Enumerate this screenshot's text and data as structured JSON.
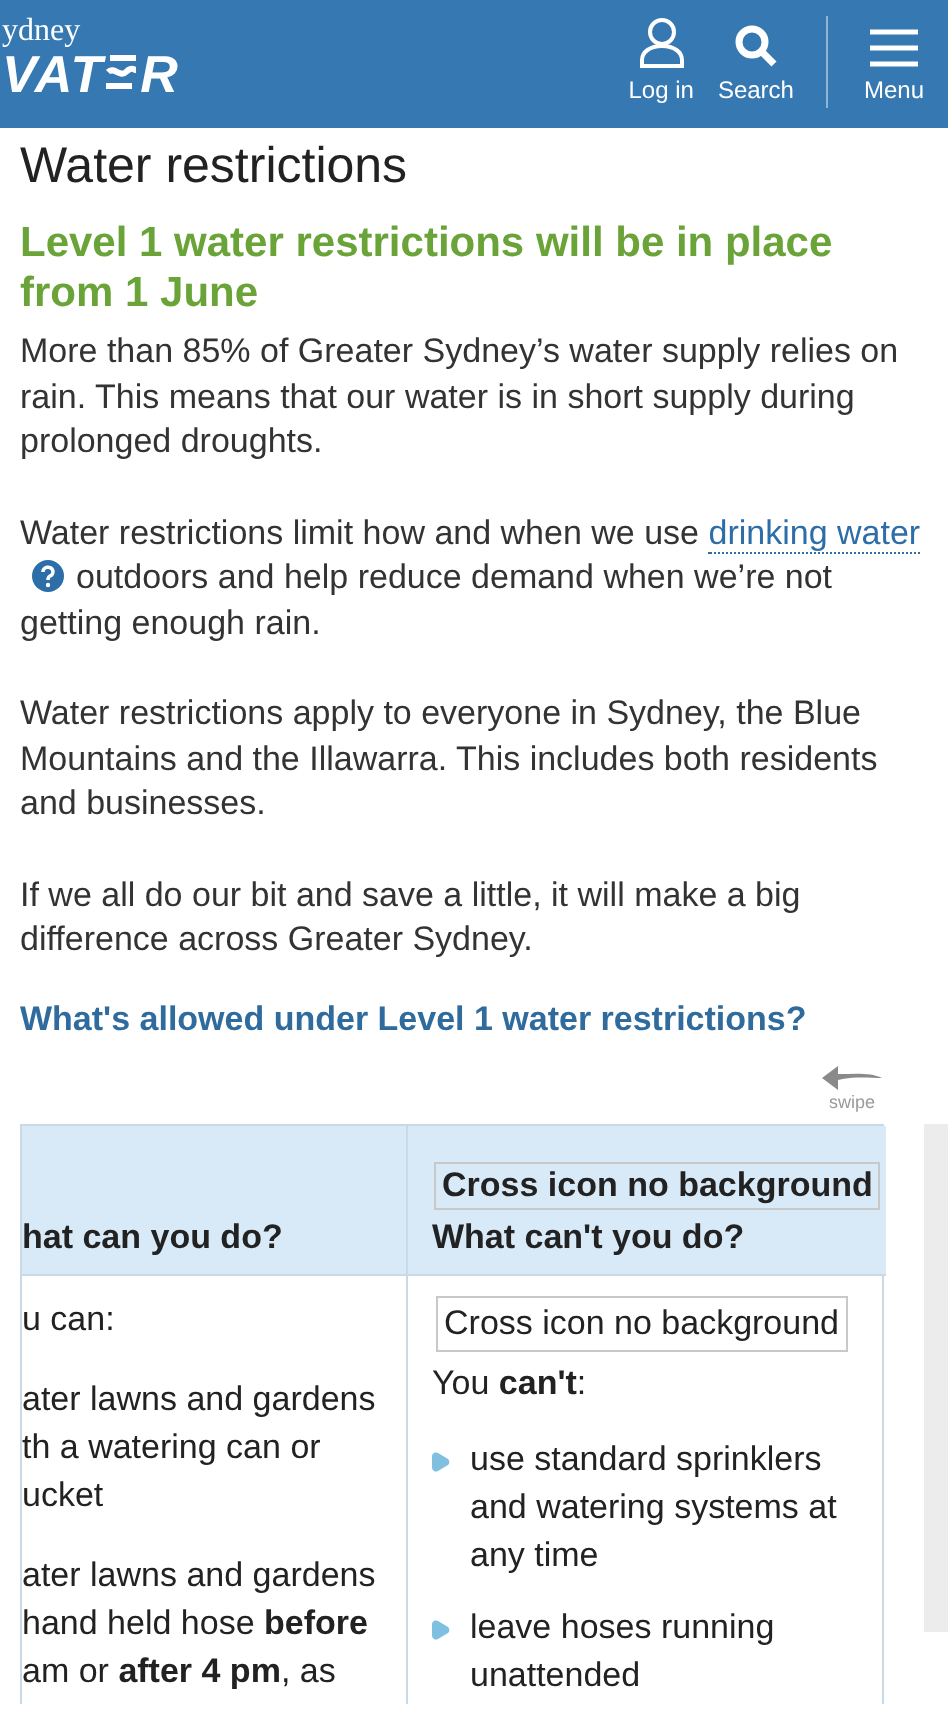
{
  "header": {
    "logo_small": "ydney",
    "logo_left": "VAT",
    "logo_right": "R",
    "nav": [
      {
        "kind": "user",
        "label": "Log in"
      },
      {
        "kind": "search",
        "label": "Search"
      },
      {
        "kind": "menu",
        "label": "Menu"
      }
    ]
  },
  "page_title": "Water restrictions",
  "headline": "Level 1 water restrictions will be in place from 1 June",
  "paragraphs": [
    {
      "text": "More than 85% of Greater Sydney’s water supply relies on rain. This means that our water is in short supply during prolonged droughts."
    },
    {
      "before": "Water restrictions limit how and when we use",
      "link": "drinking water",
      "after": "outdoors and help reduce demand when we’re not getting enough rain."
    },
    {
      "text": "Water restrictions apply to everyone in Sydney, the Blue Mountains and the Illawarra. This includes both residents and businesses."
    },
    {
      "text": "If we all do our bit and save a little, it will make a big difference across Greater Sydney."
    }
  ],
  "subheading": "What's allowed under Level 1 water restrictions?",
  "swipe_label": "swipe",
  "table": {
    "columns": [
      {
        "text": "hat can you do?"
      },
      {
        "alt": "Cross icon no background",
        "text": "What can't you do?"
      }
    ],
    "left": {
      "intro": "u can:",
      "items": [
        {
          "lines": [
            "ater lawns and gardens",
            "th a watering can or",
            "ucket"
          ]
        },
        {
          "lines": [
            "ater lawns and gardens",
            "hand held hose **before**",
            "am or **after 4 pm**, as"
          ]
        }
      ]
    },
    "right": {
      "alt": "Cross icon no background",
      "intro": "You **can't**:",
      "items": [
        {
          "text": "use standard sprinklers and watering systems at any time"
        },
        {
          "text": "leave hoses running unattended"
        }
      ]
    }
  }
}
